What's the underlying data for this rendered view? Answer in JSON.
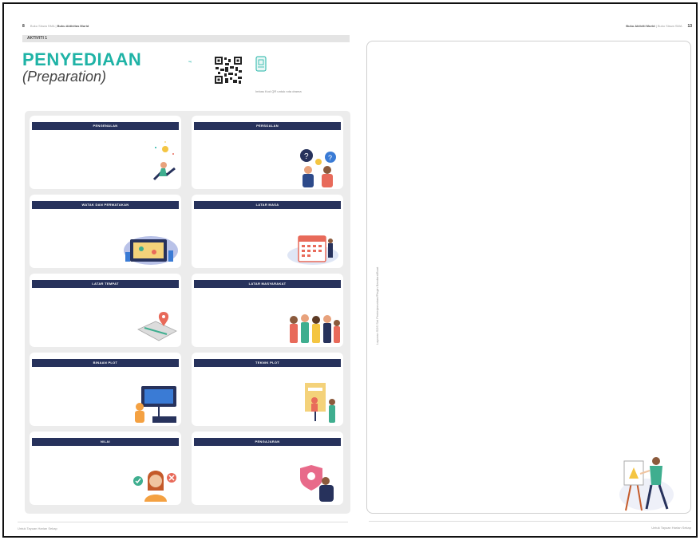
{
  "left_page": {
    "number": "8",
    "header_muted": "Buku Siswa SMA",
    "header_bold": "Buku Aktivitas Murid",
    "activity_label": "AKTIVITI 1",
    "title": "PENYEDIAAN",
    "subtitle": "(Preparation)",
    "tag": "tag",
    "qr_text": "Imbas Kod QR untuk rota drama",
    "footer": "Untuk Tayuan Harian Sekap"
  },
  "cards": [
    {
      "label": "PENGENALAN",
      "icon": "person-with-lightbulb-icon"
    },
    {
      "label": "PERSOALAN",
      "icon": "people-with-question-marks-icon"
    },
    {
      "label": "WATAK DAN PERWATAKAN",
      "icon": "stage-map-icon"
    },
    {
      "label": "LATAR MASA",
      "icon": "calendar-icon"
    },
    {
      "label": "LATAR TEMPAT",
      "icon": "map-pin-icon"
    },
    {
      "label": "LATAR MASYARAKAT",
      "icon": "community-group-icon"
    },
    {
      "label": "BINAAN PLOT",
      "icon": "presentation-board-icon"
    },
    {
      "label": "TEKNIK PLOT",
      "icon": "easel-presenter-icon"
    },
    {
      "label": "NILAI",
      "icon": "thinking-woman-icon"
    },
    {
      "label": "PENGAJARAN",
      "icon": "shield-teacher-icon"
    }
  ],
  "right_page": {
    "number": "13",
    "header_bold": "Buku Aktiviti Murid",
    "header_muted": "Buku Siswa SMA",
    "vertical_caption": "Laporan SDS Set Penterjemahan/Pingin Bandara/Buat",
    "footer": "Untuk Tayuan Harian Sekap"
  },
  "colors": {
    "title_teal": "#1fb3a6",
    "card_header_navy": "#27325c",
    "panel_gray": "#ececec"
  }
}
